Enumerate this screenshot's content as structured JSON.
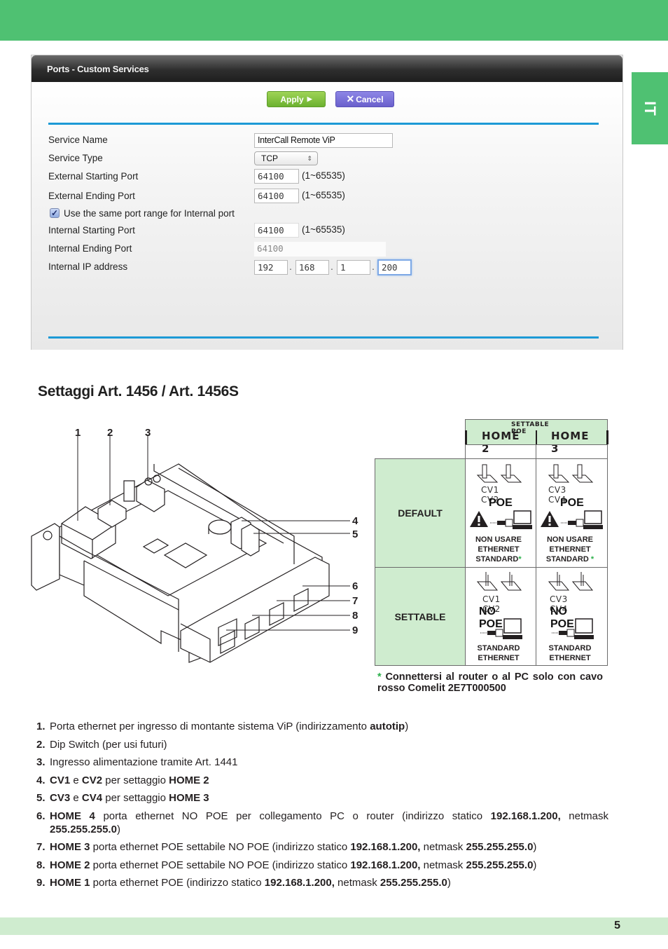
{
  "page": {
    "language_tab": "IT",
    "section_title": "Settaggi Art. 1456 / Art. 1456S",
    "page_number": "5",
    "colors": {
      "brand_green": "#4fc172",
      "light_green": "#cfeccf",
      "link_blue": "#1d9ad6",
      "star_green": "#2bb04a"
    }
  },
  "router": {
    "panel_title": "Ports - Custom Services",
    "apply_label": "Apply",
    "cancel_label": "Cancel",
    "apply_icon": "play-arrow-icon",
    "cancel_icon": "close-x-icon",
    "fields": {
      "service_name": {
        "label": "Service Name",
        "value": "InterCall Remote ViP"
      },
      "service_type": {
        "label": "Service Type",
        "value": "TCP"
      },
      "ext_start": {
        "label": "External Starting Port",
        "value": "64100",
        "range": "(1~65535)"
      },
      "ext_end": {
        "label": "External Ending Port",
        "value": "64100",
        "range": "(1~65535)"
      },
      "same_range": {
        "label": "Use the same port range for Internal port",
        "checked": true
      },
      "int_start": {
        "label": "Internal Starting Port",
        "value": "64100",
        "range": "(1~65535)"
      },
      "int_end": {
        "label": "Internal Ending Port",
        "value": "64100"
      },
      "int_ip": {
        "label": "Internal IP address",
        "octets": [
          "192",
          "168",
          "1",
          "200"
        ],
        "separator": "."
      }
    }
  },
  "device": {
    "callouts": [
      "1",
      "2",
      "3",
      "4",
      "5",
      "6",
      "7",
      "8",
      "9"
    ]
  },
  "settings_table": {
    "group_header": "SETTABLE POE",
    "columns": [
      "HOME 2",
      "HOME 3"
    ],
    "rows": [
      {
        "label": "DEFAULT",
        "cells": [
          {
            "switches": "CV1  CV2",
            "mode": "POE",
            "note_lines": [
              "NON USARE",
              "ETHERNET",
              "STANDARD"
            ],
            "star": "*",
            "warning": true
          },
          {
            "switches": "CV3  CV4",
            "mode": "POE",
            "note_lines": [
              "NON USARE",
              "ETHERNET",
              "STANDARD"
            ],
            "star": "*",
            "warning": true
          }
        ]
      },
      {
        "label": "SETTABLE",
        "cells": [
          {
            "switches": "CV1  CV2",
            "mode": "NO POE",
            "note_lines": [
              "STANDARD",
              "ETHERNET"
            ],
            "warning": false
          },
          {
            "switches": "CV3  CV4",
            "mode": "NO POE",
            "note_lines": [
              "STANDARD",
              "ETHERNET"
            ],
            "warning": false
          }
        ]
      }
    ],
    "footnote_star": "*",
    "footnote": "Connettersi al router o al PC solo con cavo rosso Comelit 2E7T000500"
  },
  "legend": [
    {
      "num": "1.",
      "parts": [
        [
          "t",
          "Porta ethernet per ingresso di montante sistema ViP (indirizzamento "
        ],
        [
          "b",
          "autotip"
        ],
        [
          "t",
          ")"
        ]
      ]
    },
    {
      "num": "2.",
      "parts": [
        [
          "t",
          "Dip Switch (per usi futuri)"
        ]
      ]
    },
    {
      "num": "3.",
      "parts": [
        [
          "t",
          "Ingresso alimentazione tramite Art. 1441"
        ]
      ]
    },
    {
      "num": "4.",
      "parts": [
        [
          "b",
          "CV1"
        ],
        [
          "t",
          " e "
        ],
        [
          "b",
          "CV2"
        ],
        [
          "t",
          " per settaggio "
        ],
        [
          "b",
          "HOME 2"
        ]
      ]
    },
    {
      "num": "5.",
      "parts": [
        [
          "b",
          "CV3"
        ],
        [
          "t",
          " e "
        ],
        [
          "b",
          "CV4"
        ],
        [
          "t",
          " per settaggio "
        ],
        [
          "b",
          "HOME 3"
        ]
      ]
    },
    {
      "num": "6.",
      "parts": [
        [
          "b",
          "HOME 4"
        ],
        [
          "t",
          " porta ethernet NO POE per collegamento PC o router (indirizzo statico "
        ],
        [
          "b",
          "192.168.1.200,"
        ],
        [
          "t",
          " netmask "
        ],
        [
          "b",
          "255.255.255.0"
        ],
        [
          "t",
          ")"
        ]
      ]
    },
    {
      "num": "7.",
      "parts": [
        [
          "b",
          "HOME 3"
        ],
        [
          "t",
          " porta ethernet POE settabile NO POE (indirizzo statico "
        ],
        [
          "b",
          "192.168.1.200,"
        ],
        [
          "t",
          " netmask "
        ],
        [
          "b",
          "255.255.255.0"
        ],
        [
          "t",
          ")"
        ]
      ]
    },
    {
      "num": "8.",
      "parts": [
        [
          "b",
          "HOME 2"
        ],
        [
          "t",
          " porta ethernet POE settabile NO POE (indirizzo statico "
        ],
        [
          "b",
          "192.168.1.200,"
        ],
        [
          "t",
          " netmask "
        ],
        [
          "b",
          "255.255.255.0"
        ],
        [
          "t",
          ")"
        ]
      ]
    },
    {
      "num": "9.",
      "parts": [
        [
          "b",
          "HOME 1"
        ],
        [
          "t",
          " porta ethernet POE (indirizzo statico "
        ],
        [
          "b",
          "192.168.1.200,"
        ],
        [
          "t",
          " netmask "
        ],
        [
          "b",
          "255.255.255.0"
        ],
        [
          "t",
          ")"
        ]
      ]
    }
  ]
}
